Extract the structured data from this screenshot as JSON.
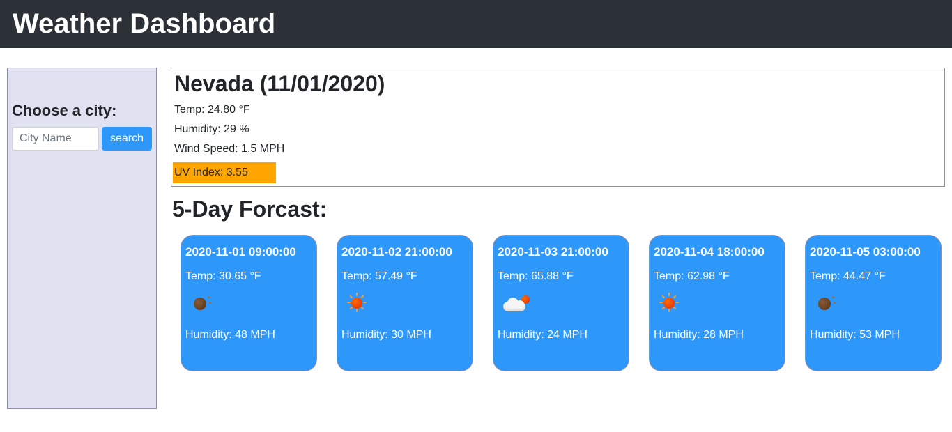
{
  "header": {
    "title": "Weather Dashboard"
  },
  "sidebar": {
    "heading": "Choose a city:",
    "search_placeholder": "City Name",
    "search_value": "",
    "search_button_label": "search"
  },
  "current": {
    "title": "Nevada (11/01/2020)",
    "temp_line": "Temp: 24.80 °F",
    "humidity_line": "Humidity: 29 %",
    "wind_line": "Wind Speed: 1.5 MPH",
    "uv_line": "UV Index: 3.55",
    "uv_color": "orange"
  },
  "forecast_title": "5-Day Forcast:",
  "forecast": [
    {
      "datetime": "2020-11-01 09:00:00",
      "temp_line": "Temp: 30.65 °F",
      "icon": "haze",
      "humidity_line": "Humidity: 48 MPH"
    },
    {
      "datetime": "2020-11-02 21:00:00",
      "temp_line": "Temp: 57.49 °F",
      "icon": "sun",
      "humidity_line": "Humidity: 30 MPH"
    },
    {
      "datetime": "2020-11-03 21:00:00",
      "temp_line": "Temp: 65.88 °F",
      "icon": "partly",
      "humidity_line": "Humidity: 24 MPH"
    },
    {
      "datetime": "2020-11-04 18:00:00",
      "temp_line": "Temp: 62.98 °F",
      "icon": "sun",
      "humidity_line": "Humidity: 28 MPH"
    },
    {
      "datetime": "2020-11-05 03:00:00",
      "temp_line": "Temp: 44.47 °F",
      "icon": "haze",
      "humidity_line": "Humidity: 53 MPH"
    }
  ]
}
